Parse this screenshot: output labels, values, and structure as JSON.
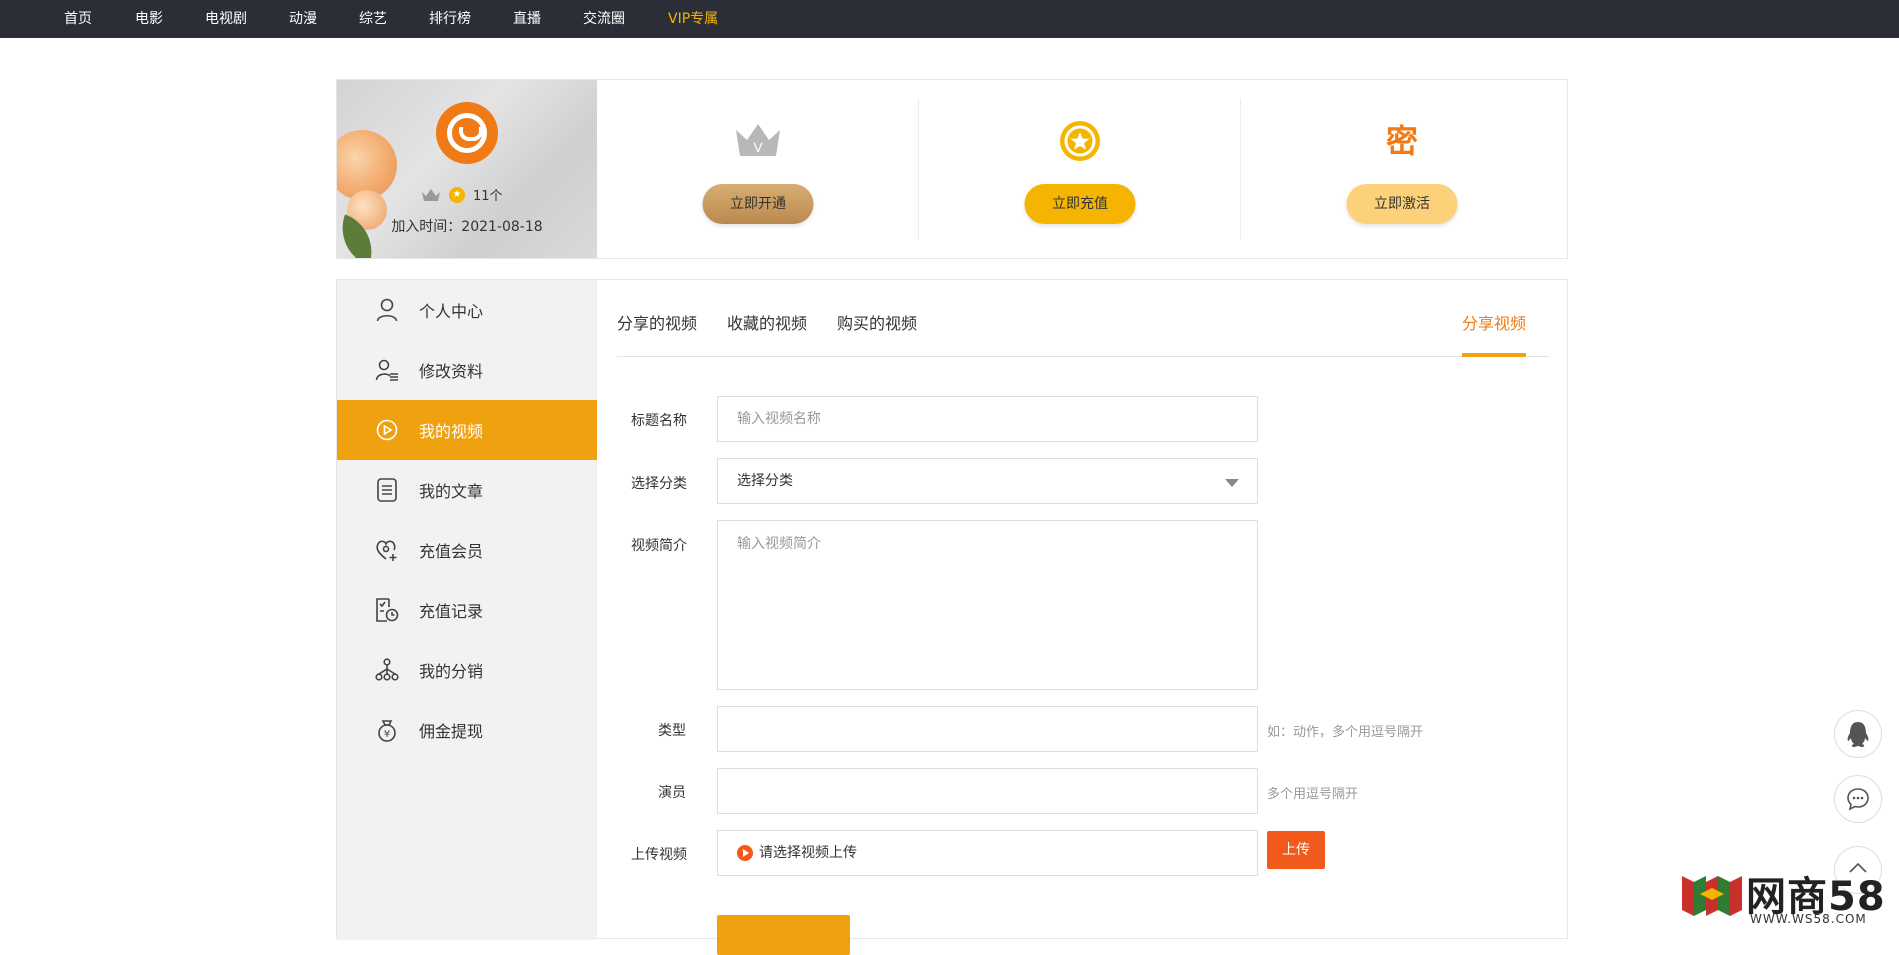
{
  "nav": {
    "items": [
      "首页",
      "电影",
      "电视剧",
      "动漫",
      "综艺",
      "排行榜",
      "直播",
      "交流圈"
    ],
    "vip": "VIP专属"
  },
  "profile": {
    "count_label": "11个",
    "join_date": "加入时间：2021-08-18"
  },
  "perks": [
    {
      "icon": "crown-icon",
      "button": "立即开通",
      "color": "#c9975a"
    },
    {
      "icon": "star-coin-icon",
      "button": "立即充值",
      "color": "#f5b400"
    },
    {
      "icon": "secret-char",
      "icon_text": "密",
      "button": "立即激活",
      "color": "#fbd27a"
    }
  ],
  "sidebar": {
    "items": [
      {
        "label": "个人中心",
        "icon": "user-icon"
      },
      {
        "label": "修改资料",
        "icon": "user-edit-icon"
      },
      {
        "label": "我的视频",
        "icon": "play-circle-icon",
        "active": true
      },
      {
        "label": "我的文章",
        "icon": "document-icon"
      },
      {
        "label": "充值会员",
        "icon": "heart-add-icon"
      },
      {
        "label": "充值记录",
        "icon": "receipt-clock-icon"
      },
      {
        "label": "我的分销",
        "icon": "network-icon"
      },
      {
        "label": "佣金提现",
        "icon": "money-bag-icon"
      }
    ]
  },
  "tabs": {
    "shared": "分享的视频",
    "favorites": "收藏的视频",
    "purchased": "购买的视频",
    "share_video": "分享视频"
  },
  "form": {
    "title_label": "标题名称",
    "title_placeholder": "输入视频名称",
    "category_label": "选择分类",
    "category_value": "选择分类",
    "intro_label": "视频简介",
    "intro_placeholder": "输入视频简介",
    "type_label": "类型",
    "type_hint": "如：动作，多个用逗号隔开",
    "actor_label": "演员",
    "actor_hint": "多个用逗号隔开",
    "upload_label": "上传视频",
    "upload_text": "请选择视频上传",
    "upload_button": "上传"
  },
  "watermark": {
    "brand": "网商58",
    "url": "WWW.WS58.COM"
  },
  "colors": {
    "accent": "#f0a10f",
    "orange": "#f07a15",
    "nav_bg": "#2b2e37",
    "upload_red": "#f25a1c"
  }
}
